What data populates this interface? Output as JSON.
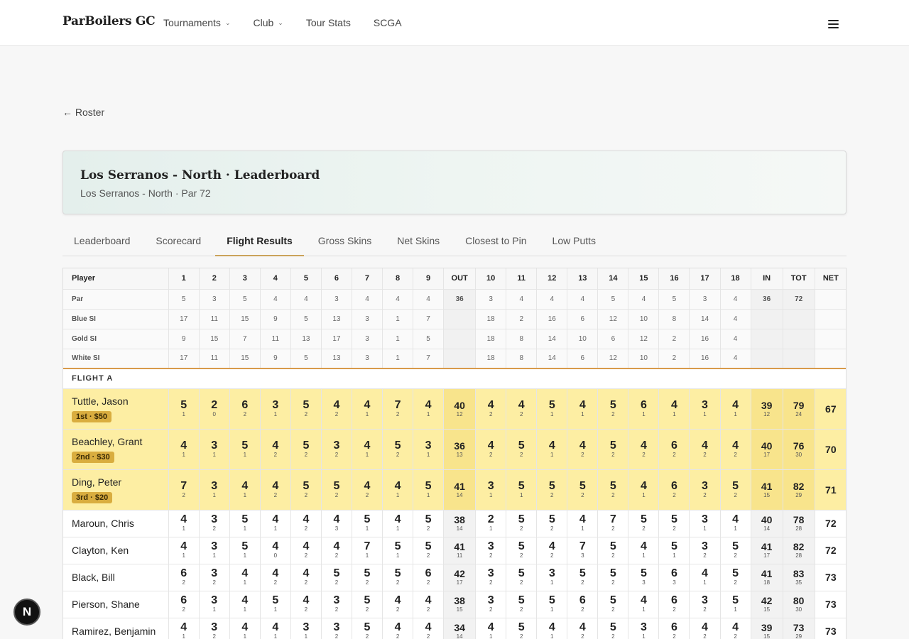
{
  "nav": {
    "brand": "ParBoilers GC",
    "items": [
      {
        "label": "Tournaments",
        "dropdown": true
      },
      {
        "label": "Club",
        "dropdown": true
      },
      {
        "label": "Tour Stats",
        "dropdown": false
      },
      {
        "label": "SCGA",
        "dropdown": false
      }
    ],
    "menu_icon": "hamburger-menu-icon"
  },
  "back_link": "← Roster",
  "header": {
    "title": "Los Serranos - North · Leaderboard",
    "subtitle": "Los Serranos - North · Par 72"
  },
  "tabs": [
    {
      "label": "Leaderboard",
      "active": false
    },
    {
      "label": "Scorecard",
      "active": false
    },
    {
      "label": "Flight Results",
      "active": true
    },
    {
      "label": "Gross Skins",
      "active": false
    },
    {
      "label": "Net Skins",
      "active": false
    },
    {
      "label": "Closest to Pin",
      "active": false
    },
    {
      "label": "Low Putts",
      "active": false
    }
  ],
  "table": {
    "columns": [
      "Player",
      "1",
      "2",
      "3",
      "4",
      "5",
      "6",
      "7",
      "8",
      "9",
      "OUT",
      "10",
      "11",
      "12",
      "13",
      "14",
      "15",
      "16",
      "17",
      "18",
      "IN",
      "TOT",
      "NET"
    ],
    "info_rows": [
      {
        "label": "Par",
        "values": [
          "5",
          "3",
          "5",
          "4",
          "4",
          "3",
          "4",
          "4",
          "4",
          "36",
          "3",
          "4",
          "4",
          "4",
          "5",
          "4",
          "5",
          "3",
          "4",
          "36",
          "72",
          ""
        ]
      },
      {
        "label": "Blue SI",
        "values": [
          "17",
          "11",
          "15",
          "9",
          "5",
          "13",
          "3",
          "1",
          "7",
          "",
          "18",
          "2",
          "16",
          "6",
          "12",
          "10",
          "8",
          "14",
          "4",
          "",
          "",
          ""
        ]
      },
      {
        "label": "Gold SI",
        "values": [
          "9",
          "15",
          "7",
          "11",
          "13",
          "17",
          "3",
          "1",
          "5",
          "",
          "18",
          "8",
          "14",
          "10",
          "6",
          "12",
          "2",
          "16",
          "4",
          "",
          "",
          ""
        ]
      },
      {
        "label": "White SI",
        "values": [
          "17",
          "11",
          "15",
          "9",
          "5",
          "13",
          "3",
          "1",
          "7",
          "",
          "18",
          "8",
          "14",
          "6",
          "12",
          "10",
          "2",
          "16",
          "4",
          "",
          "",
          ""
        ]
      }
    ],
    "flight_label": "FLIGHT A",
    "players": [
      {
        "name": "Tuttle, Jason",
        "badge": "1st · $50",
        "scores": [
          [
            "5",
            "1"
          ],
          [
            "2",
            "0"
          ],
          [
            "6",
            "2"
          ],
          [
            "3",
            "1"
          ],
          [
            "5",
            "2"
          ],
          [
            "4",
            "2"
          ],
          [
            "4",
            "1"
          ],
          [
            "7",
            "2"
          ],
          [
            "4",
            "1"
          ],
          [
            "40",
            "12"
          ],
          [
            "4",
            "2"
          ],
          [
            "4",
            "2"
          ],
          [
            "5",
            "1"
          ],
          [
            "4",
            "1"
          ],
          [
            "5",
            "2"
          ],
          [
            "6",
            "1"
          ],
          [
            "4",
            "1"
          ],
          [
            "3",
            "1"
          ],
          [
            "4",
            "1"
          ],
          [
            "39",
            "12"
          ],
          [
            "79",
            "24"
          ]
        ],
        "net": "67"
      },
      {
        "name": "Beachley, Grant",
        "badge": "2nd · $30",
        "scores": [
          [
            "4",
            "1"
          ],
          [
            "3",
            "1"
          ],
          [
            "5",
            "1"
          ],
          [
            "4",
            "2"
          ],
          [
            "5",
            "2"
          ],
          [
            "3",
            "2"
          ],
          [
            "4",
            "1"
          ],
          [
            "5",
            "2"
          ],
          [
            "3",
            "1"
          ],
          [
            "36",
            "13"
          ],
          [
            "4",
            "2"
          ],
          [
            "5",
            "2"
          ],
          [
            "4",
            "1"
          ],
          [
            "4",
            "2"
          ],
          [
            "5",
            "2"
          ],
          [
            "4",
            "2"
          ],
          [
            "6",
            "2"
          ],
          [
            "4",
            "2"
          ],
          [
            "4",
            "2"
          ],
          [
            "40",
            "17"
          ],
          [
            "76",
            "30"
          ]
        ],
        "net": "70"
      },
      {
        "name": "Ding, Peter",
        "badge": "3rd · $20",
        "scores": [
          [
            "7",
            "2"
          ],
          [
            "3",
            "1"
          ],
          [
            "4",
            "1"
          ],
          [
            "4",
            "2"
          ],
          [
            "5",
            "2"
          ],
          [
            "5",
            "2"
          ],
          [
            "4",
            "2"
          ],
          [
            "4",
            "1"
          ],
          [
            "5",
            "1"
          ],
          [
            "41",
            "14"
          ],
          [
            "3",
            "1"
          ],
          [
            "5",
            "1"
          ],
          [
            "5",
            "2"
          ],
          [
            "5",
            "2"
          ],
          [
            "5",
            "2"
          ],
          [
            "4",
            "1"
          ],
          [
            "6",
            "2"
          ],
          [
            "3",
            "2"
          ],
          [
            "5",
            "2"
          ],
          [
            "41",
            "15"
          ],
          [
            "82",
            "29"
          ]
        ],
        "net": "71"
      },
      {
        "name": "Maroun, Chris",
        "badge": "",
        "scores": [
          [
            "4",
            "1"
          ],
          [
            "3",
            "2"
          ],
          [
            "5",
            "1"
          ],
          [
            "4",
            "1"
          ],
          [
            "4",
            "2"
          ],
          [
            "4",
            "3"
          ],
          [
            "5",
            "1"
          ],
          [
            "4",
            "1"
          ],
          [
            "5",
            "2"
          ],
          [
            "38",
            "14"
          ],
          [
            "2",
            "1"
          ],
          [
            "5",
            "2"
          ],
          [
            "5",
            "2"
          ],
          [
            "4",
            "1"
          ],
          [
            "7",
            "2"
          ],
          [
            "5",
            "2"
          ],
          [
            "5",
            "2"
          ],
          [
            "3",
            "1"
          ],
          [
            "4",
            "1"
          ],
          [
            "40",
            "14"
          ],
          [
            "78",
            "28"
          ]
        ],
        "net": "72"
      },
      {
        "name": "Clayton, Ken",
        "badge": "",
        "scores": [
          [
            "4",
            "1"
          ],
          [
            "3",
            "1"
          ],
          [
            "5",
            "1"
          ],
          [
            "4",
            "0"
          ],
          [
            "4",
            "2"
          ],
          [
            "4",
            "2"
          ],
          [
            "7",
            "1"
          ],
          [
            "5",
            "1"
          ],
          [
            "5",
            "2"
          ],
          [
            "41",
            "11"
          ],
          [
            "3",
            "2"
          ],
          [
            "5",
            "2"
          ],
          [
            "4",
            "2"
          ],
          [
            "7",
            "3"
          ],
          [
            "5",
            "2"
          ],
          [
            "4",
            "1"
          ],
          [
            "5",
            "1"
          ],
          [
            "3",
            "2"
          ],
          [
            "5",
            "2"
          ],
          [
            "41",
            "17"
          ],
          [
            "82",
            "28"
          ]
        ],
        "net": "72"
      },
      {
        "name": "Black, Bill",
        "badge": "",
        "scores": [
          [
            "6",
            "2"
          ],
          [
            "3",
            "2"
          ],
          [
            "4",
            "1"
          ],
          [
            "4",
            "2"
          ],
          [
            "4",
            "2"
          ],
          [
            "5",
            "2"
          ],
          [
            "5",
            "2"
          ],
          [
            "5",
            "2"
          ],
          [
            "6",
            "2"
          ],
          [
            "42",
            "17"
          ],
          [
            "3",
            "2"
          ],
          [
            "5",
            "2"
          ],
          [
            "3",
            "1"
          ],
          [
            "5",
            "2"
          ],
          [
            "5",
            "2"
          ],
          [
            "5",
            "3"
          ],
          [
            "6",
            "3"
          ],
          [
            "4",
            "1"
          ],
          [
            "5",
            "2"
          ],
          [
            "41",
            "18"
          ],
          [
            "83",
            "35"
          ]
        ],
        "net": "73"
      },
      {
        "name": "Pierson, Shane",
        "badge": "",
        "scores": [
          [
            "6",
            "2"
          ],
          [
            "3",
            "1"
          ],
          [
            "4",
            "1"
          ],
          [
            "5",
            "1"
          ],
          [
            "4",
            "2"
          ],
          [
            "3",
            "2"
          ],
          [
            "5",
            "2"
          ],
          [
            "4",
            "2"
          ],
          [
            "4",
            "2"
          ],
          [
            "38",
            "15"
          ],
          [
            "3",
            "2"
          ],
          [
            "5",
            "2"
          ],
          [
            "5",
            "1"
          ],
          [
            "6",
            "2"
          ],
          [
            "5",
            "2"
          ],
          [
            "4",
            "1"
          ],
          [
            "6",
            "2"
          ],
          [
            "3",
            "2"
          ],
          [
            "5",
            "1"
          ],
          [
            "42",
            "15"
          ],
          [
            "80",
            "30"
          ]
        ],
        "net": "73"
      },
      {
        "name": "Ramirez, Benjamin",
        "badge": "",
        "scores": [
          [
            "4",
            "1"
          ],
          [
            "3",
            "2"
          ],
          [
            "4",
            "1"
          ],
          [
            "4",
            "1"
          ],
          [
            "3",
            "1"
          ],
          [
            "3",
            "2"
          ],
          [
            "5",
            "2"
          ],
          [
            "4",
            "2"
          ],
          [
            "4",
            "2"
          ],
          [
            "34",
            "14"
          ],
          [
            "4",
            "1"
          ],
          [
            "5",
            "2"
          ],
          [
            "4",
            "1"
          ],
          [
            "4",
            "2"
          ],
          [
            "5",
            "2"
          ],
          [
            "3",
            "1"
          ],
          [
            "6",
            "2"
          ],
          [
            "4",
            "2"
          ],
          [
            "4",
            "2"
          ],
          [
            "39",
            "15"
          ],
          [
            "73",
            "29"
          ]
        ],
        "net": "73"
      }
    ]
  },
  "floating_badge": "N"
}
